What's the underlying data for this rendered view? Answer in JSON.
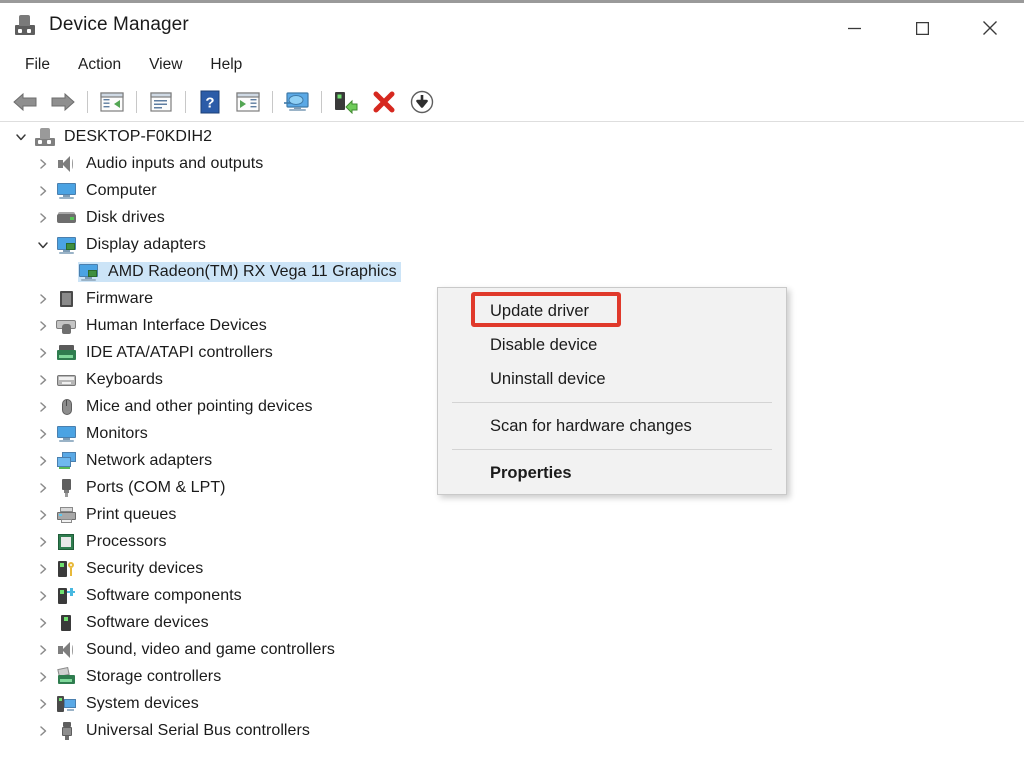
{
  "window": {
    "title": "Device Manager",
    "app_icon": "device-manager-icon",
    "controls": {
      "minimize": "minimize-button",
      "maximize": "maximize-button",
      "close": "close-button"
    }
  },
  "menubar": {
    "items": [
      {
        "label": "File"
      },
      {
        "label": "Action"
      },
      {
        "label": "View"
      },
      {
        "label": "Help"
      }
    ]
  },
  "toolbar": {
    "buttons": [
      {
        "name": "back-icon"
      },
      {
        "name": "forward-icon"
      },
      {
        "name": "show-hide-console-tree-icon"
      },
      {
        "name": "properties-icon"
      },
      {
        "name": "help-icon"
      },
      {
        "name": "show-hide-action-pane-icon"
      },
      {
        "name": "scan-for-hardware-changes-icon"
      },
      {
        "name": "update-driver-icon"
      },
      {
        "name": "uninstall-device-icon"
      },
      {
        "name": "disable-device-icon"
      }
    ]
  },
  "tree": {
    "root": {
      "label": "DESKTOP-F0KDIH2",
      "expanded": true,
      "icon": "computer-root-icon"
    },
    "items": [
      {
        "label": "Audio inputs and outputs",
        "icon": "speaker-icon",
        "expanded": false,
        "level": 1
      },
      {
        "label": "Computer",
        "icon": "computer-icon",
        "expanded": false,
        "level": 1
      },
      {
        "label": "Disk drives",
        "icon": "disk-drive-icon",
        "expanded": false,
        "level": 1
      },
      {
        "label": "Display adapters",
        "icon": "display-adapter-icon",
        "expanded": true,
        "level": 1
      },
      {
        "label": "AMD Radeon(TM) RX Vega 11 Graphics",
        "icon": "display-adapter-icon",
        "expanded": null,
        "level": 2,
        "selected": true
      },
      {
        "label": "Firmware",
        "icon": "firmware-icon",
        "expanded": false,
        "level": 1
      },
      {
        "label": "Human Interface Devices",
        "icon": "human-interface-device-icon",
        "expanded": false,
        "level": 1
      },
      {
        "label": "IDE ATA/ATAPI controllers",
        "icon": "ide-controller-icon",
        "expanded": false,
        "level": 1
      },
      {
        "label": "Keyboards",
        "icon": "keyboard-icon",
        "expanded": false,
        "level": 1
      },
      {
        "label": "Mice and other pointing devices",
        "icon": "mouse-icon",
        "expanded": false,
        "level": 1
      },
      {
        "label": "Monitors",
        "icon": "monitor-icon",
        "expanded": false,
        "level": 1
      },
      {
        "label": "Network adapters",
        "icon": "network-adapter-icon",
        "expanded": false,
        "level": 1
      },
      {
        "label": "Ports (COM & LPT)",
        "icon": "port-icon",
        "expanded": false,
        "level": 1
      },
      {
        "label": "Print queues",
        "icon": "printer-icon",
        "expanded": false,
        "level": 1
      },
      {
        "label": "Processors",
        "icon": "processor-icon",
        "expanded": false,
        "level": 1
      },
      {
        "label": "Security devices",
        "icon": "security-device-icon",
        "expanded": false,
        "level": 1
      },
      {
        "label": "Software components",
        "icon": "software-component-icon",
        "expanded": false,
        "level": 1
      },
      {
        "label": "Software devices",
        "icon": "software-device-icon",
        "expanded": false,
        "level": 1
      },
      {
        "label": "Sound, video and game controllers",
        "icon": "speaker-icon",
        "expanded": false,
        "level": 1
      },
      {
        "label": "Storage controllers",
        "icon": "storage-controller-icon",
        "expanded": false,
        "level": 1
      },
      {
        "label": "System devices",
        "icon": "system-device-icon",
        "expanded": false,
        "level": 1
      },
      {
        "label": "Universal Serial Bus controllers",
        "icon": "usb-icon",
        "expanded": false,
        "level": 1
      }
    ]
  },
  "context_menu": {
    "items": [
      {
        "label": "Update driver",
        "bold": false,
        "highlighted": true
      },
      {
        "label": "Disable device",
        "bold": false,
        "highlighted": false
      },
      {
        "label": "Uninstall device",
        "bold": false,
        "highlighted": false
      },
      {
        "separator": true
      },
      {
        "label": "Scan for hardware changes",
        "bold": false,
        "highlighted": false
      },
      {
        "separator": true
      },
      {
        "label": "Properties",
        "bold": true,
        "highlighted": false
      }
    ]
  },
  "colors": {
    "selection": "#cce4f7",
    "highlight_box": "#e0392b",
    "menu_background": "#f2f2f2",
    "window_background": "#ffffff",
    "text": "#1b1b1b"
  }
}
